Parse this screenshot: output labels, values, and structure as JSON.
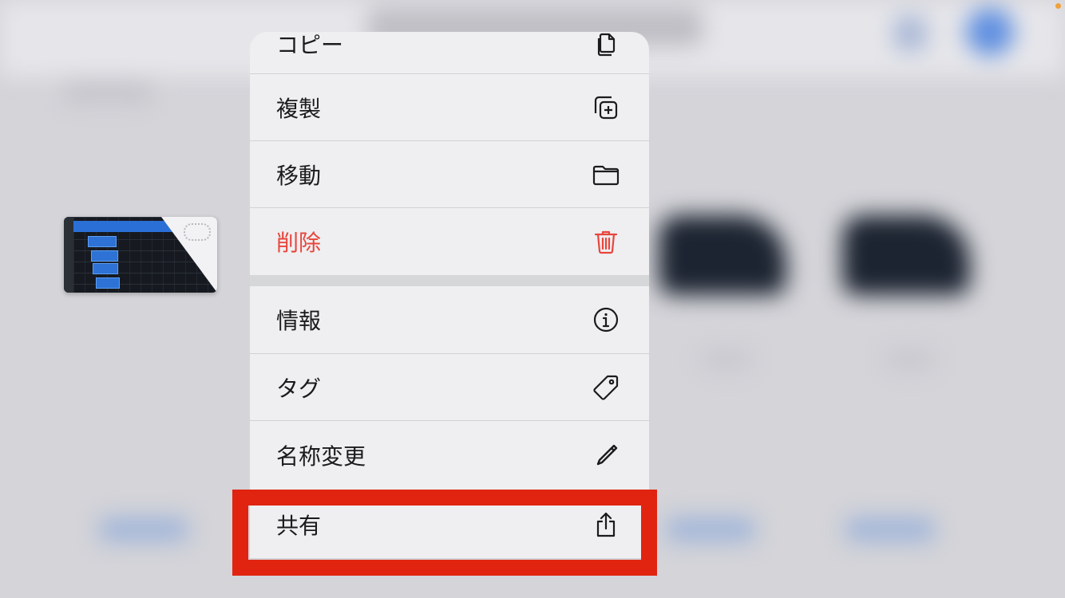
{
  "menu": {
    "items": [
      {
        "label": "コピー",
        "icon": "copy-doc-icon",
        "destructive": false
      },
      {
        "label": "複製",
        "icon": "duplicate-plus-icon",
        "destructive": false
      },
      {
        "label": "移動",
        "icon": "folder-icon",
        "destructive": false
      },
      {
        "label": "削除",
        "icon": "trash-icon",
        "destructive": true
      },
      {
        "label": "情報",
        "icon": "info-circle-icon",
        "destructive": false
      },
      {
        "label": "タグ",
        "icon": "tag-icon",
        "destructive": false
      },
      {
        "label": "名称変更",
        "icon": "pencil-icon",
        "destructive": false
      },
      {
        "label": "共有",
        "icon": "share-icon",
        "destructive": false,
        "highlighted": true
      }
    ]
  },
  "colors": {
    "destructive": "#e8453c",
    "highlight_border": "#e02410",
    "menu_background": "#efeff1",
    "accent_blue": "#2a6fd6"
  }
}
